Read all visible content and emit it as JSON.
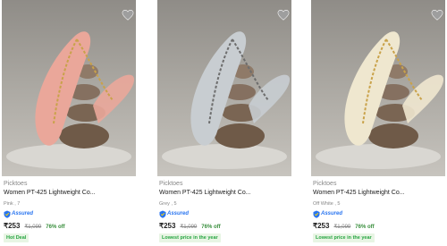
{
  "products": [
    {
      "brand": "Picktoes",
      "title": "Women PT-425 Lightweight Co...",
      "variant": "Pink , 7",
      "assured_label": "Assured",
      "price": "₹253",
      "mrp": "₹1,099",
      "discount": "76% off",
      "tag": "Hot Deal",
      "sandal_color": "#eaa79a",
      "image_icon": "sandal-photo"
    },
    {
      "brand": "Picktoes",
      "title": "Women PT-425 Lightweight Co...",
      "variant": "Grey , 5",
      "assured_label": "Assured",
      "price": "₹253",
      "mrp": "₹1,099",
      "discount": "76% off",
      "tag": "Lowest price in the year",
      "sandal_color": "#c8cdd1",
      "image_icon": "sandal-photo"
    },
    {
      "brand": "Picktoes",
      "title": "Women PT-425 Lightweight Co...",
      "variant": "Off White , 5",
      "assured_label": "Assured",
      "price": "₹253",
      "mrp": "₹1,099",
      "discount": "76% off",
      "tag": "Lowest price in the year",
      "sandal_color": "#efe7cf",
      "image_icon": "sandal-photo"
    }
  ],
  "colors": {
    "assured_blue": "#2874f0",
    "discount_green": "#388e3c",
    "tag_bg": "#e8f5e4",
    "tag_text": "#26a541",
    "stone": "#6f5a48",
    "strap_gold": "#c9a24a"
  },
  "icons": {
    "wishlist": "heart-icon",
    "assured": "shield-check-icon"
  }
}
